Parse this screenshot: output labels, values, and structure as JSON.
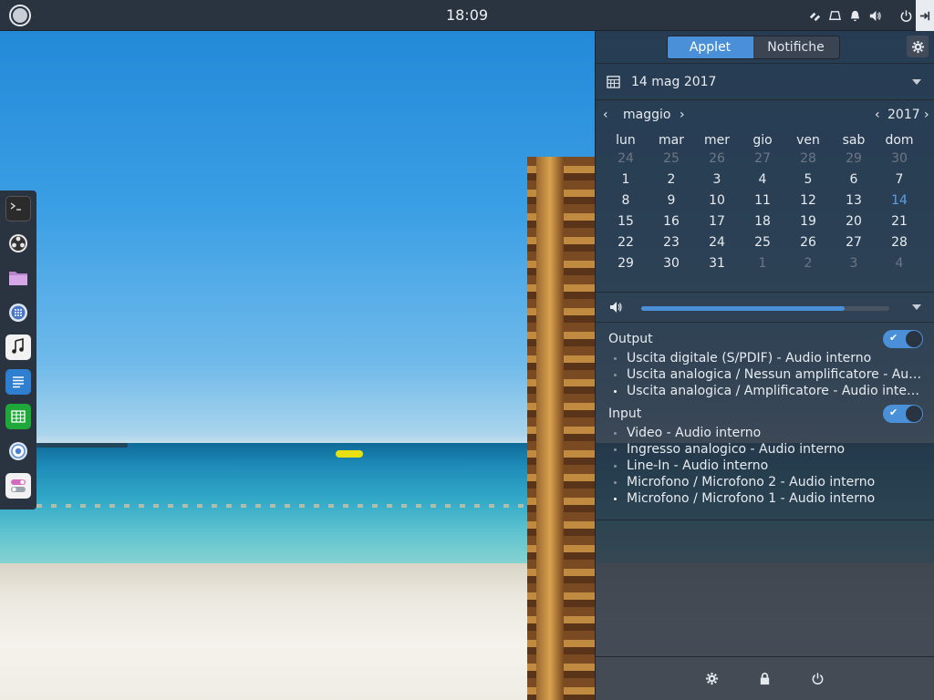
{
  "topbar": {
    "clock": "18:09",
    "icons": [
      "menu-icon",
      "network-icon",
      "removable-drive-icon",
      "bell-icon",
      "volume-icon",
      "power-icon",
      "sidebar-toggle-icon"
    ]
  },
  "dock": {
    "items": [
      "terminal-icon",
      "budgie-welcome-icon",
      "files-icon",
      "app-grid-icon",
      "music-icon",
      "text-editor-icon",
      "spreadsheet-icon",
      "chrome-icon",
      "settings-toggle-icon"
    ]
  },
  "panel": {
    "tabs": [
      "Applet",
      "Notifiche"
    ],
    "date": "14 mag 2017",
    "calendar": {
      "month": "maggio",
      "year": "2017",
      "weekdays": [
        "lun",
        "mar",
        "mer",
        "gio",
        "ven",
        "sab",
        "dom"
      ],
      "weeks": [
        [
          "24",
          "25",
          "26",
          "27",
          "28",
          "29",
          "30"
        ],
        [
          "1",
          "2",
          "3",
          "4",
          "5",
          "6",
          "7"
        ],
        [
          "8",
          "9",
          "10",
          "11",
          "12",
          "13",
          "14"
        ],
        [
          "15",
          "16",
          "17",
          "18",
          "19",
          "20",
          "21"
        ],
        [
          "22",
          "23",
          "24",
          "25",
          "26",
          "27",
          "28"
        ],
        [
          "29",
          "30",
          "31",
          "1",
          "2",
          "3",
          "4"
        ]
      ],
      "today": "14"
    },
    "volume_level": 0.82,
    "sound": {
      "output_label": "Output",
      "outputs": [
        "Uscita digitale (S/PDIF) - Audio interno",
        "Uscita analogica / Nessun amplificatore - Audio interno",
        "Uscita analogica / Amplificatore - Audio interno"
      ],
      "output_selected": 2,
      "input_label": "Input",
      "inputs": [
        "Video - Audio interno",
        "Ingresso analogico - Audio interno",
        "Line-In - Audio interno",
        "Microfono / Microfono 2 - Audio interno",
        "Microfono / Microfono 1 - Audio interno"
      ],
      "input_selected": 4
    },
    "footer_icons": [
      "settings-icon",
      "lock-icon",
      "power-icon"
    ]
  },
  "colors": {
    "accent": "#4a90d9",
    "panel_bg": "#2a3340"
  }
}
